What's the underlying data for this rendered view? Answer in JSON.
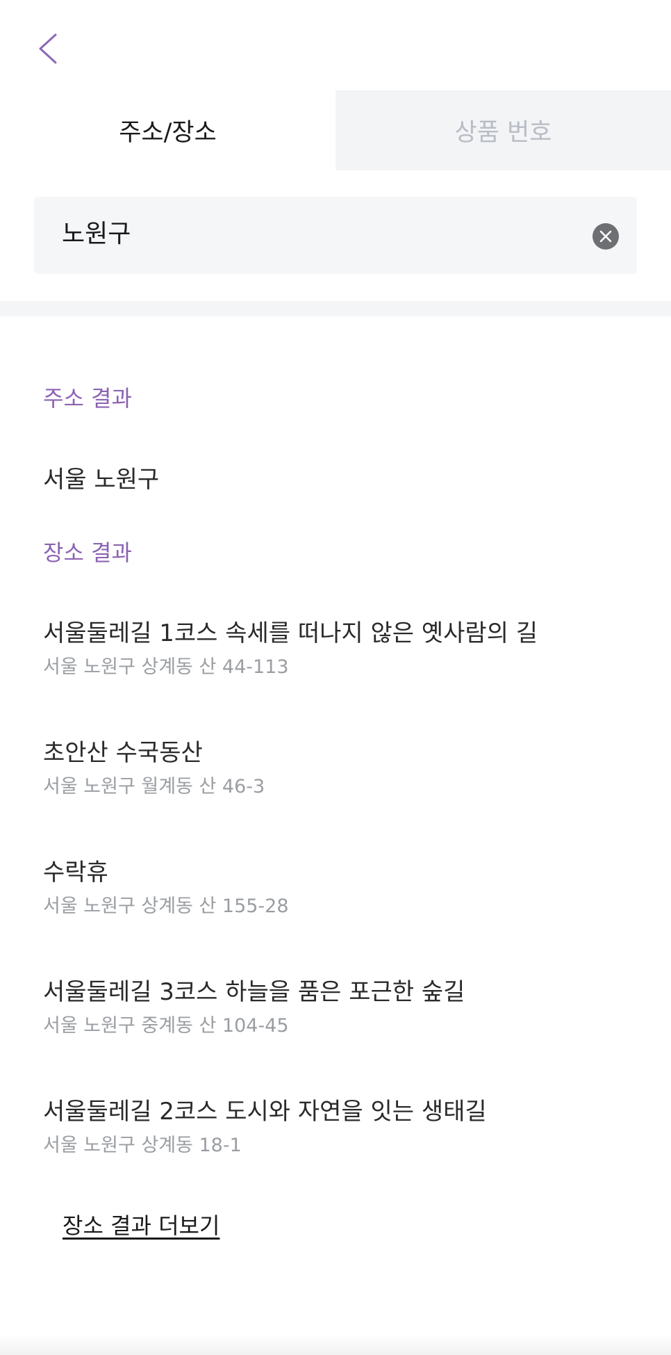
{
  "header": {
    "back_icon": "chevron-left-icon"
  },
  "tabs": [
    {
      "label": "주소/장소",
      "active": true
    },
    {
      "label": "상품 번호",
      "active": false
    }
  ],
  "search": {
    "value": "노원구",
    "clear_icon": "close-circle-icon"
  },
  "address_section": {
    "title": "주소 결과",
    "items": [
      {
        "label": "서울 노원구"
      }
    ]
  },
  "place_section": {
    "title": "장소 결과",
    "items": [
      {
        "name": "서울둘레길 1코스 속세를 떠나지 않은 옛사람의 길",
        "address": "서울 노원구 상계동 산 44-113"
      },
      {
        "name": "초안산 수국동산",
        "address": "서울 노원구 월계동 산 46-3"
      },
      {
        "name": "수락휴",
        "address": "서울 노원구 상계동 산 155-28"
      },
      {
        "name": "서울둘레길 3코스 하늘을 품은 포근한 숲길",
        "address": "서울 노원구 중계동 산 104-45"
      },
      {
        "name": "서울둘레길 2코스 도시와 자연을 잇는 생태길",
        "address": "서울 노원구 상계동 18-1"
      }
    ],
    "more_label": "장소 결과 더보기"
  },
  "colors": {
    "accent": "#8b63b3",
    "back_icon": "#8a68b5",
    "inactive_tab_bg": "#f3f4f6",
    "inactive_tab_text": "#b8bcc4",
    "secondary_text": "#9a9da2"
  }
}
